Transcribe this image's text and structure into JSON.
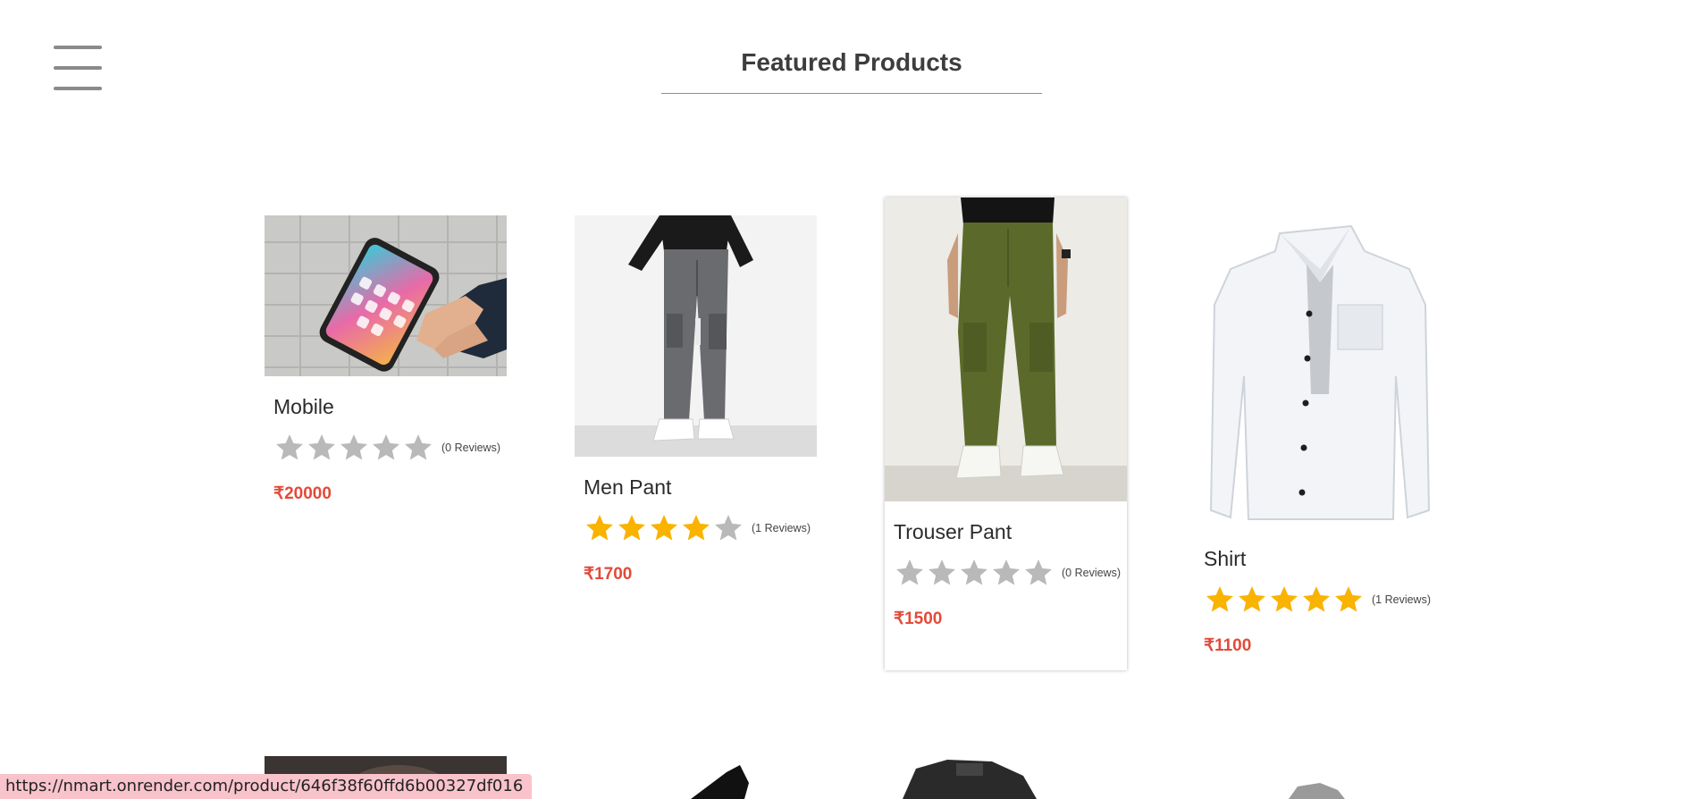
{
  "page": {
    "heading": "Featured Products"
  },
  "products": [
    {
      "name": "Mobile",
      "rating": 0,
      "reviews": "(0 Reviews)",
      "price": "₹20000"
    },
    {
      "name": "Men Pant",
      "rating": 4,
      "reviews": "(1 Reviews)",
      "price": "₹1700"
    },
    {
      "name": "Trouser Pant",
      "rating": 0,
      "reviews": "(0 Reviews)",
      "price": "₹1500"
    },
    {
      "name": "Shirt",
      "rating": 5,
      "reviews": "(1 Reviews)",
      "price": "₹1100"
    }
  ],
  "status_bar": {
    "url": "https://nmart.onrender.com/product/646f38f60ffd6b00327df016"
  },
  "colors": {
    "price": "#e24a39",
    "star_filled": "#f9b300",
    "star_empty": "#b9b9b9"
  }
}
